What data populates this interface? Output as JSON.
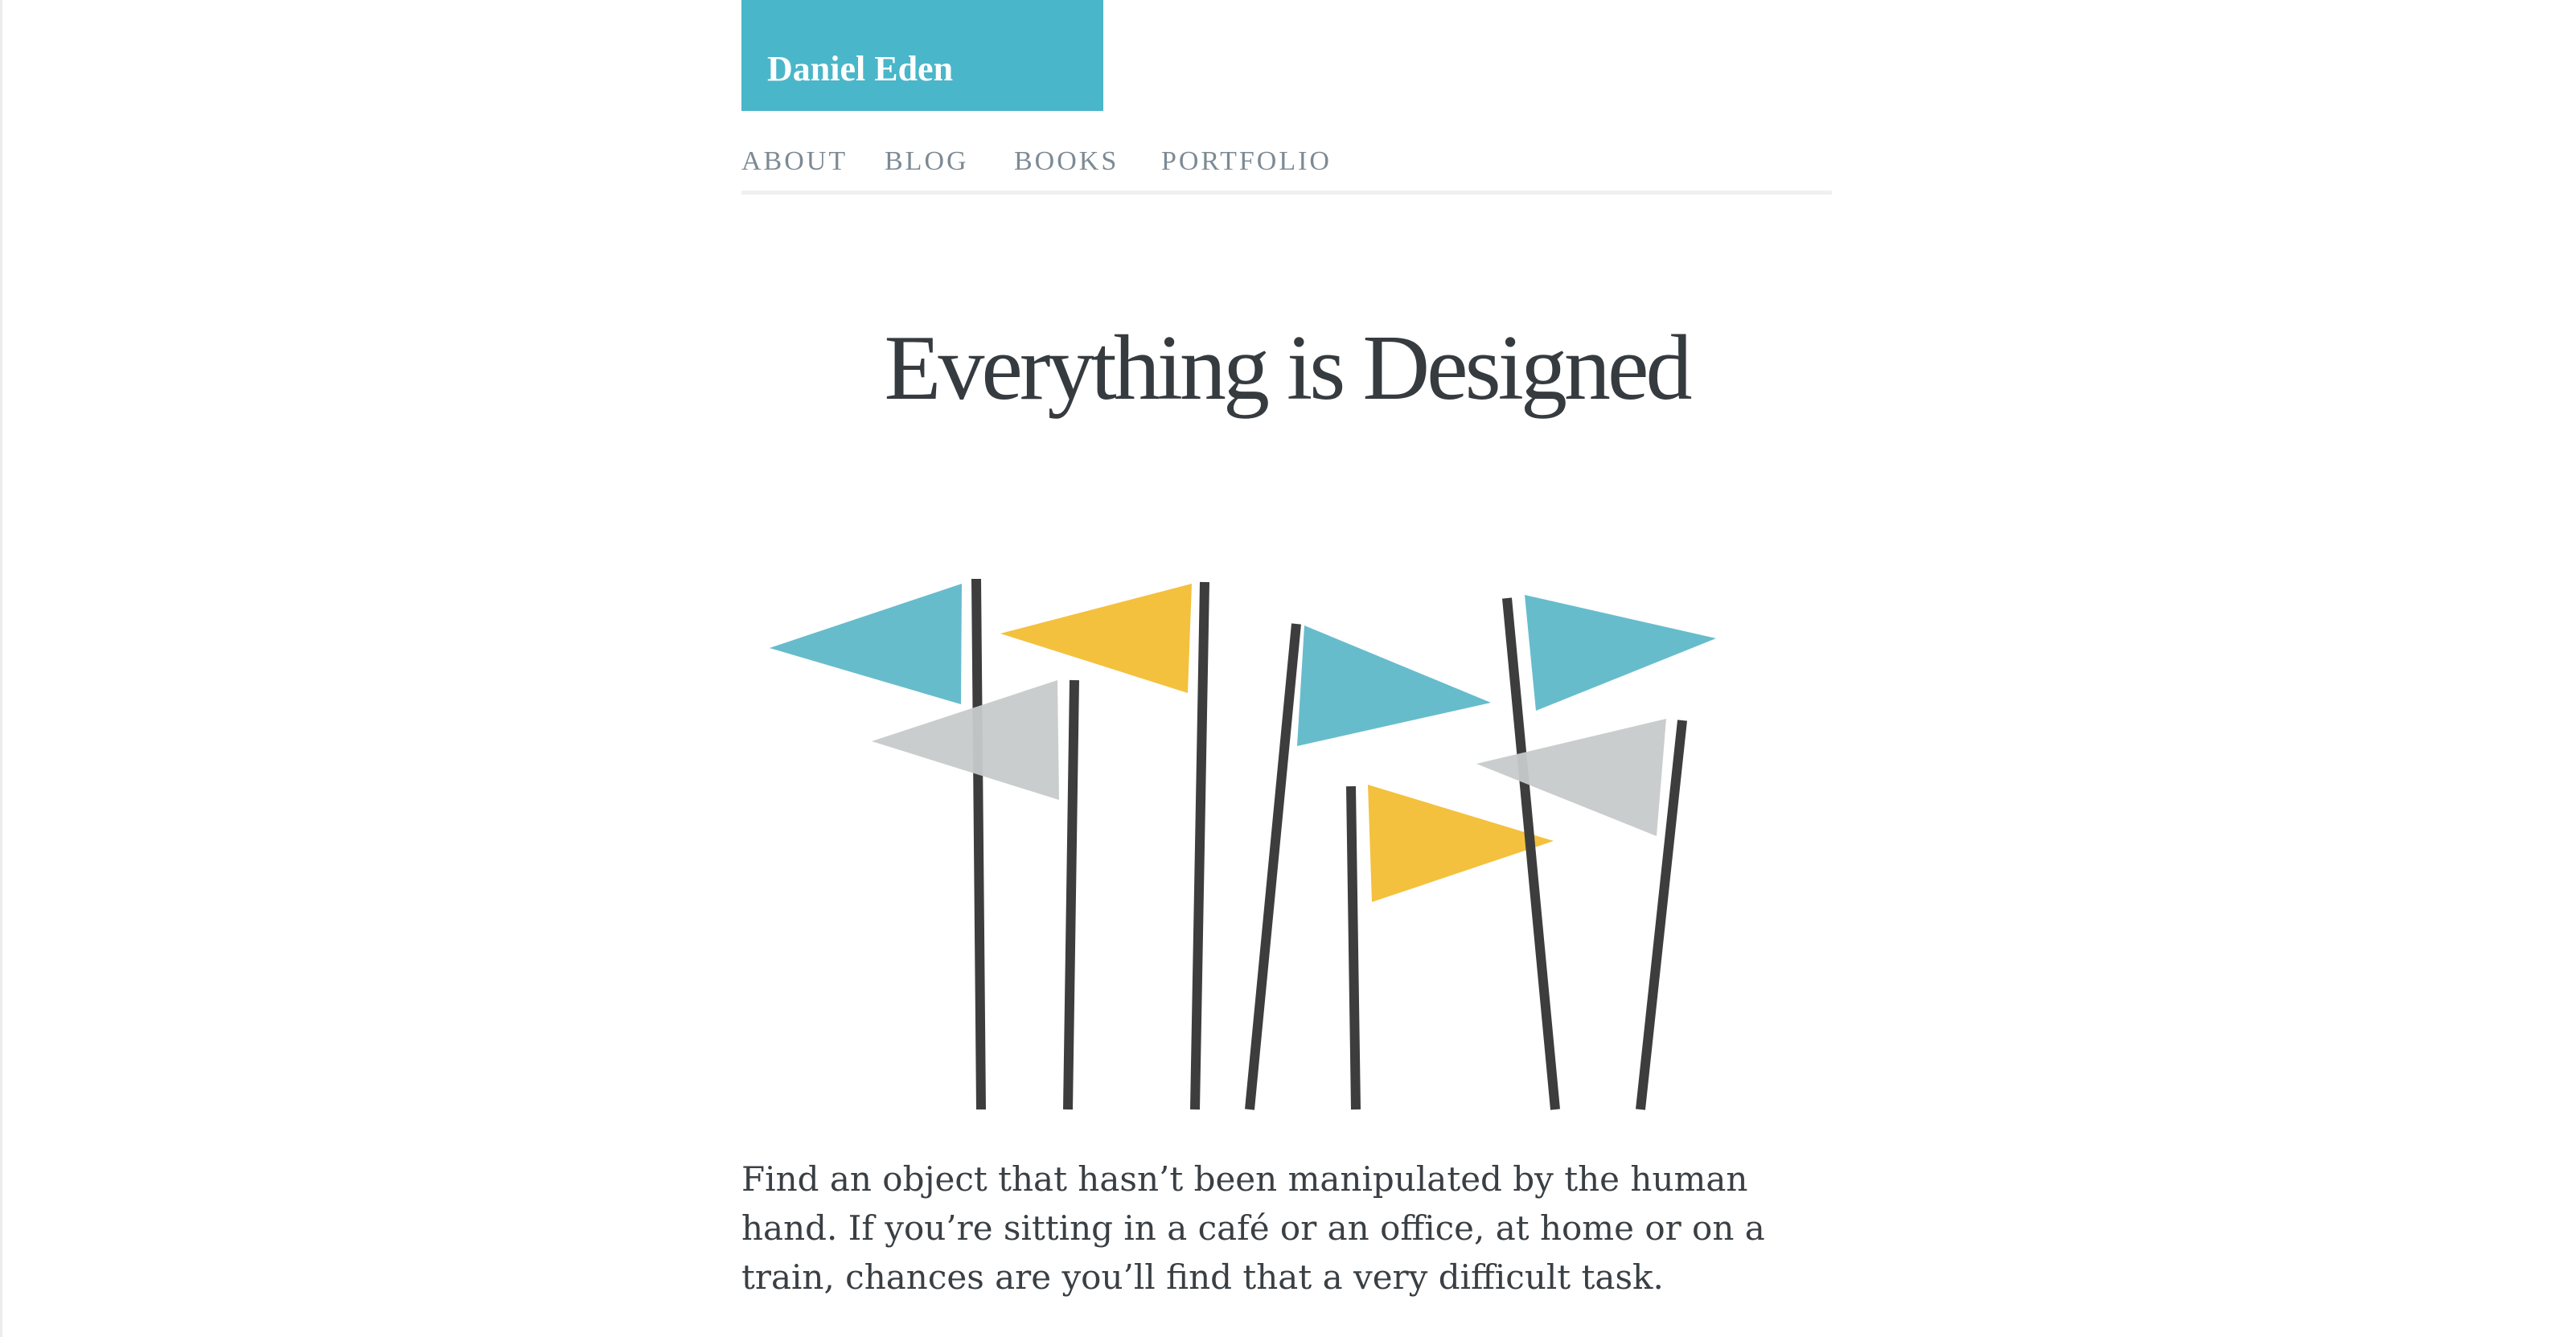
{
  "site": {
    "brand": "Daniel Eden",
    "brand_color": "#4ab6c9"
  },
  "nav": {
    "items": [
      {
        "label": "ABOUT"
      },
      {
        "label": "BLOG"
      },
      {
        "label": "BOOKS"
      },
      {
        "label": "PORTFOLIO"
      }
    ]
  },
  "article": {
    "title": "Everything is Designed",
    "intro": "Find an object that hasn’t been manipulated by the human hand. If you’re sitting in a café or an office, at home or on a train, chances are you’ll find that a very difficult task."
  },
  "illustration": {
    "subject": "flags-on-poles",
    "colors": {
      "pole": "#3d3d3d",
      "blue": "#67bccc",
      "yellow": "#f4c13e",
      "gray": "#c7cacb"
    }
  }
}
